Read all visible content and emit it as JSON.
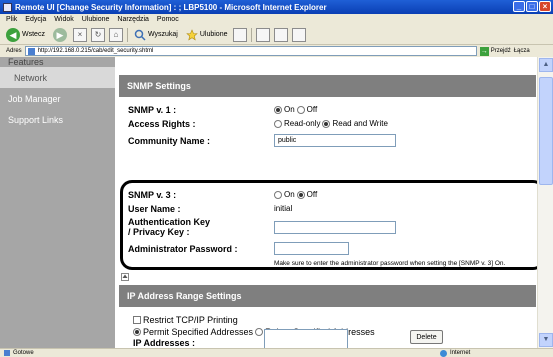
{
  "window": {
    "title": "Remote UI [Change Security Information] : ; LBP5100 - Microsoft Internet Explorer",
    "buttons": {
      "minimize": "_",
      "maximize": "□",
      "close": "×"
    }
  },
  "menu": [
    "Plik",
    "Edycja",
    "Widok",
    "Ulubione",
    "Narzędzia",
    "Pomoc"
  ],
  "toolbar": {
    "back": "Wstecz",
    "back_glyph": "◀",
    "forward_glyph": "▶",
    "stop_glyph": "×",
    "refresh_glyph": "↻",
    "home_glyph": "⌂",
    "search": "Wyszukaj",
    "favorites": "Ulubione"
  },
  "address": {
    "label": "Adres",
    "url": "http://192.168.0.215/cab/edit_security.shtml",
    "go": "Przejdź",
    "links": "Łącza"
  },
  "sidebar": {
    "items": [
      {
        "label": "Features"
      },
      {
        "label": "Network"
      },
      {
        "label": "Job Manager"
      },
      {
        "label": "Support Links"
      }
    ]
  },
  "snmp": {
    "header": "SNMP Settings",
    "v1_label": "SNMP v. 1 :",
    "v1_on": "On",
    "v1_off": "Off",
    "access_label": "Access Rights :",
    "access_read": "Read-only",
    "access_rw": "Read and Write",
    "community_label": "Community Name :",
    "community_value": "public",
    "v3_label": "SNMP v. 3 :",
    "v3_on": "On",
    "v3_off": "Off",
    "user_label": "User Name :",
    "user_value": "initial",
    "auth_label_line1": "Authentication Key",
    "auth_label_line2": "/ Privacy Key :",
    "admin_label": "Administrator Password :",
    "note": "Make sure to enter the administrator password when setting the [SNMP v. 3] On."
  },
  "ip": {
    "header": "IP Address Range Settings",
    "restrict": "Restrict TCP/IP Printing",
    "permit": "Permit Specified Addresses",
    "reject": "Reject Specified Addresses",
    "addr_label": "IP Addresses :",
    "delete": "Delete"
  },
  "status": {
    "text": "Gotowe",
    "zone": "Internet"
  }
}
